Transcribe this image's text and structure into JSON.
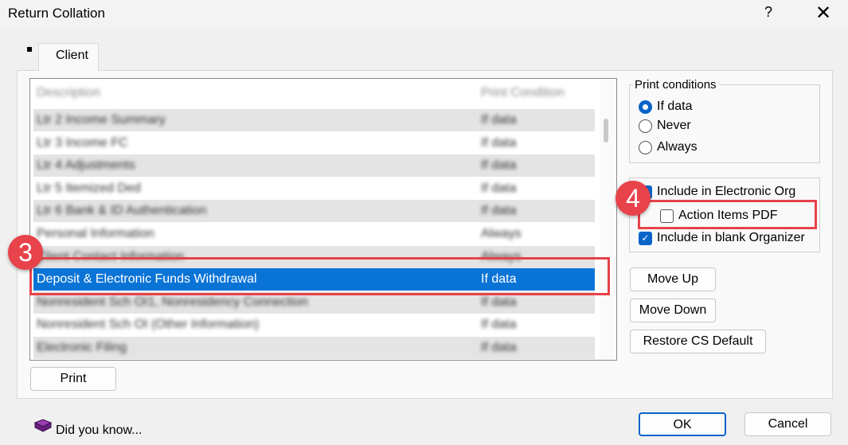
{
  "window": {
    "title": "Return Collation",
    "help": "?",
    "close": "✕"
  },
  "tabs": [
    {
      "label": "Client"
    }
  ],
  "list": {
    "header": {
      "description": "Description",
      "condition": "Print Condition"
    },
    "rows": [
      {
        "description": "Ltr 2 Income Summary",
        "condition": "If data"
      },
      {
        "description": "Ltr 3 Income FC",
        "condition": "If data"
      },
      {
        "description": "Ltr 4 Adjustments",
        "condition": "If data"
      },
      {
        "description": "Ltr 5 Itemized Ded",
        "condition": "If data"
      },
      {
        "description": "Ltr 6 Bank & ID Authentication",
        "condition": "If data"
      },
      {
        "description": "Personal Information",
        "condition": "Always"
      },
      {
        "description": "Client Contact Information",
        "condition": "Always"
      },
      {
        "description": "Deposit & Electronic Funds Withdrawal",
        "condition": "If data"
      },
      {
        "description": "Nonresident Sch OI1, Nonresidency Connection",
        "condition": "If data"
      },
      {
        "description": "Nonresident Sch OI (Other Information)",
        "condition": "If data"
      },
      {
        "description": "Electronic Filing",
        "condition": "If data"
      }
    ],
    "selected_index": 7
  },
  "print_button": "Print",
  "print_conditions": {
    "legend": "Print conditions",
    "options": [
      "If data",
      "Never",
      "Always"
    ],
    "selected": "If data"
  },
  "checkboxes": [
    {
      "label": "Include in Electronic Org",
      "checked": true
    },
    {
      "label": "Action Items PDF",
      "checked": false
    },
    {
      "label": "Include in blank Organizer",
      "checked": true
    }
  ],
  "buttons": {
    "move_up": "Move Up",
    "move_down": "Move Down",
    "restore": "Restore CS Default",
    "ok": "OK",
    "cancel": "Cancel"
  },
  "did_you_know": "Did you know...",
  "annotations": {
    "badge3": "3",
    "badge4": "4",
    "color": "#e8424a"
  }
}
